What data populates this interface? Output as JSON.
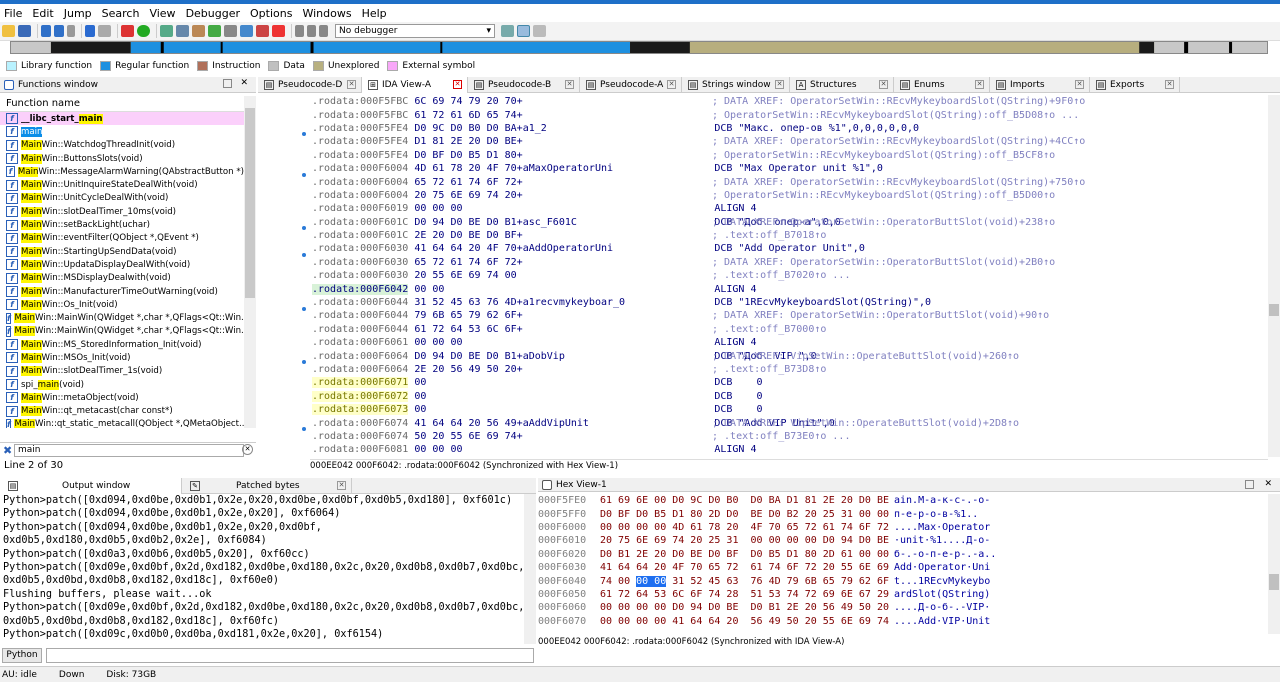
{
  "menu": [
    "File",
    "Edit",
    "Jump",
    "Search",
    "View",
    "Debugger",
    "Options",
    "Windows",
    "Help"
  ],
  "toolbar": {
    "debugger_value": "No debugger"
  },
  "legend": [
    {
      "label": "Library function",
      "color": "#b9f2ff"
    },
    {
      "label": "Regular function",
      "color": "#1e90e0"
    },
    {
      "label": "Instruction",
      "color": "#b0705a"
    },
    {
      "label": "Data",
      "color": "#c0c0c0"
    },
    {
      "label": "Unexplored",
      "color": "#b8b080"
    },
    {
      "label": "External symbol",
      "color": "#f8a8f8"
    }
  ],
  "tabs": [
    {
      "label": "Pseudocode-D"
    },
    {
      "label": "IDA View-A"
    },
    {
      "label": "Pseudocode-B"
    },
    {
      "label": "Pseudocode-A"
    },
    {
      "label": "Strings window"
    },
    {
      "label": "Structures"
    },
    {
      "label": "Enums"
    },
    {
      "label": "Imports"
    },
    {
      "label": "Exports"
    }
  ],
  "functions_window": {
    "title": "Functions window",
    "column": "Function name",
    "search_value": "main",
    "status": "Line 2 of 30",
    "items": [
      {
        "pre": "__libc_start_",
        "hl": "main",
        "post": ""
      },
      {
        "pre": "",
        "hl": "main",
        "post": ""
      },
      {
        "pre": "",
        "hl": "Main",
        "post": "Win::WatchdogThreadInit(void)"
      },
      {
        "pre": "",
        "hl": "Main",
        "post": "Win::ButtonsSlots(void)"
      },
      {
        "pre": "",
        "hl": "Main",
        "post": "Win::MessageAlarmWarning(QAbstractButton *)"
      },
      {
        "pre": "",
        "hl": "Main",
        "post": "Win::UnitInquireStateDealWith(void)"
      },
      {
        "pre": "",
        "hl": "Main",
        "post": "Win::UnitCycleDealWith(void)"
      },
      {
        "pre": "",
        "hl": "Main",
        "post": "Win::slotDealTimer_10ms(void)"
      },
      {
        "pre": "",
        "hl": "Main",
        "post": "Win::setBackLight(uchar)"
      },
      {
        "pre": "",
        "hl": "Main",
        "post": "Win::eventFilter(QObject *,QEvent *)"
      },
      {
        "pre": "",
        "hl": "Main",
        "post": "Win::StartingUpSendData(void)"
      },
      {
        "pre": "",
        "hl": "Main",
        "post": "Win::UpdataDisplayDealWith(void)"
      },
      {
        "pre": "",
        "hl": "Main",
        "post": "Win::MSDisplayDealwith(void)"
      },
      {
        "pre": "",
        "hl": "Main",
        "post": "Win::ManufacturerTimeOutWarning(void)"
      },
      {
        "pre": "",
        "hl": "Main",
        "post": "Win::Os_Init(void)"
      },
      {
        "pre": "",
        "hl": "Main",
        "post": "Win::MainWin(QWidget *,char *,QFlags<Qt::Win..."
      },
      {
        "pre": "",
        "hl": "Main",
        "post": "Win::MainWin(QWidget *,char *,QFlags<Qt::Win..."
      },
      {
        "pre": "",
        "hl": "Main",
        "post": "Win::MS_StoredInformation_Init(void)"
      },
      {
        "pre": "",
        "hl": "Main",
        "post": "Win::MSOs_Init(void)"
      },
      {
        "pre": "",
        "hl": "Main",
        "post": "Win::slotDealTimer_1s(void)"
      },
      {
        "pre": "spi_",
        "hl": "main",
        "post": "(void)"
      },
      {
        "pre": "",
        "hl": "Main",
        "post": "Win::metaObject(void)"
      },
      {
        "pre": "",
        "hl": "Main",
        "post": "Win::qt_metacast(char const*)"
      },
      {
        "pre": "",
        "hl": "Main",
        "post": "Win::qt_static_metacall(QObject *,QMetaObject..."
      }
    ]
  },
  "asm": {
    "lines": [
      {
        "dot": false,
        "cls": "data",
        "addr": ".rodata:000F5FBC",
        "bytes": "6C 69 74 79 20 70+",
        "label": "",
        "ins": "",
        "cmt": "; DATA XREF: OperatorSetWin::REcvMykeyboardSlot(QString)+9F0↑o"
      },
      {
        "dot": false,
        "cls": "data",
        "addr": ".rodata:000F5FBC",
        "bytes": "61 72 61 6D 65 74+",
        "label": "",
        "ins": "",
        "cmt": "; OperatorSetWin::REcvMykeyboardSlot(QString):off_B5D08↑o ..."
      },
      {
        "dot": true,
        "cls": "data",
        "addr": ".rodata:000F5FE4",
        "bytes": "D0 9C D0 B0 D0 BA+a1_2",
        "label": "",
        "ins": "DCB \"Макс. опер-ов %1\",0,0,0,0,0,0",
        "cmt": ""
      },
      {
        "dot": false,
        "cls": "data",
        "addr": ".rodata:000F5FE4",
        "bytes": "D1 81 2E 20 D0 BE+",
        "label": "",
        "ins": "",
        "cmt": "; DATA XREF: OperatorSetWin::REcvMykeyboardSlot(QString)+4CC↑o"
      },
      {
        "dot": false,
        "cls": "data",
        "addr": ".rodata:000F5FE4",
        "bytes": "D0 BF D0 B5 D1 80+",
        "label": "",
        "ins": "",
        "cmt": "; OperatorSetWin::REcvMykeyboardSlot(QString):off_B5CF8↑o"
      },
      {
        "dot": true,
        "cls": "data",
        "addr": ".rodata:000F6004",
        "bytes": "4D 61 78 20 4F 70+aMaxOperatorUni",
        "label": "",
        "ins": "DCB \"Max Operator unit %1\",0",
        "cmt": ""
      },
      {
        "dot": false,
        "cls": "data",
        "addr": ".rodata:000F6004",
        "bytes": "65 72 61 74 6F 72+",
        "label": "",
        "ins": "",
        "cmt": "; DATA XREF: OperatorSetWin::REcvMykeyboardSlot(QString)+750↑o"
      },
      {
        "dot": false,
        "cls": "data",
        "addr": ".rodata:000F6004",
        "bytes": "20 75 6E 69 74 20+",
        "label": "",
        "ins": "",
        "cmt": "; OperatorSetWin::REcvMykeyboardSlot(QString):off_B5D00↑o"
      },
      {
        "dot": false,
        "cls": "data",
        "addr": ".rodata:000F6019",
        "bytes": "00 00 00",
        "label": "",
        "ins": "ALIGN 4",
        "cmt": ""
      },
      {
        "dot": true,
        "cls": "data",
        "addr": ".rodata:000F601C",
        "bytes": "D0 94 D0 BE D0 B1+asc_F601C",
        "label": "",
        "ins": "DCB \"Доб. опер-а\",0,0",
        "cmt": "; DATA XREF: OperatorSetWin::OperatorButtSlot(void)+238↑o"
      },
      {
        "dot": false,
        "cls": "data",
        "addr": ".rodata:000F601C",
        "bytes": "2E 20 D0 BE D0 BF+",
        "label": "",
        "ins": "",
        "cmt": "; .text:off_B7018↑o"
      },
      {
        "dot": true,
        "cls": "data",
        "addr": ".rodata:000F6030",
        "bytes": "41 64 64 20 4F 70+aAddOperatorUni",
        "label": "",
        "ins": "DCB \"Add Operator Unit\",0",
        "cmt": ""
      },
      {
        "dot": false,
        "cls": "data",
        "addr": ".rodata:000F6030",
        "bytes": "65 72 61 74 6F 72+",
        "label": "",
        "ins": "",
        "cmt": "; DATA XREF: OperatorSetWin::OperatorButtSlot(void)+2B0↑o"
      },
      {
        "dot": false,
        "cls": "data",
        "addr": ".rodata:000F6030",
        "bytes": "20 55 6E 69 74 00",
        "label": "",
        "ins": "",
        "cmt": "; .text:off_B7020↑o ..."
      },
      {
        "dot": false,
        "cls": "hi",
        "addr": ".rodata:000F6042",
        "bytes": "00 00",
        "label": "",
        "ins": "ALIGN 4",
        "cmt": ""
      },
      {
        "dot": true,
        "cls": "data",
        "addr": ".rodata:000F6044",
        "bytes": "31 52 45 63 76 4D+a1recvmykeyboar_0",
        "label": "",
        "ins": "DCB \"1REcvMykeyboardSlot(QString)\",0",
        "cmt": ""
      },
      {
        "dot": false,
        "cls": "data",
        "addr": ".rodata:000F6044",
        "bytes": "79 6B 65 79 62 6F+",
        "label": "",
        "ins": "",
        "cmt": "; DATA XREF: OperatorSetWin::OperatorButtSlot(void)+90↑o"
      },
      {
        "dot": false,
        "cls": "data",
        "addr": ".rodata:000F6044",
        "bytes": "61 72 64 53 6C 6F+",
        "label": "",
        "ins": "",
        "cmt": "; .text:off_B7000↑o"
      },
      {
        "dot": false,
        "cls": "data",
        "addr": ".rodata:000F6061",
        "bytes": "00 00 00",
        "label": "",
        "ins": "ALIGN 4",
        "cmt": ""
      },
      {
        "dot": true,
        "cls": "data",
        "addr": ".rodata:000F6064",
        "bytes": "D0 94 D0 BE D0 B1+aDobVip",
        "label": "",
        "ins": "DCB \"Доб. VIP \",0",
        "cmt": "; DATA XREF: VipSetWin::OperateButtSlot(void)+260↑o"
      },
      {
        "dot": false,
        "cls": "data",
        "addr": ".rodata:000F6064",
        "bytes": "2E 20 56 49 50 20+",
        "label": "",
        "ins": "",
        "cmt": "; .text:off_B73D8↑o"
      },
      {
        "dot": false,
        "cls": "yel",
        "addr": ".rodata:000F6071",
        "bytes": "00",
        "label": "",
        "ins": "DCB    0",
        "cmt": ""
      },
      {
        "dot": false,
        "cls": "yel",
        "addr": ".rodata:000F6072",
        "bytes": "00",
        "label": "",
        "ins": "DCB    0",
        "cmt": ""
      },
      {
        "dot": false,
        "cls": "yel",
        "addr": ".rodata:000F6073",
        "bytes": "00",
        "label": "",
        "ins": "DCB    0",
        "cmt": ""
      },
      {
        "dot": true,
        "cls": "data",
        "addr": ".rodata:000F6074",
        "bytes": "41 64 64 20 56 49+aAddVipUnit",
        "label": "",
        "ins": "DCB \"Add VIP Unit\",0",
        "cmt": "; DATA XREF: VipSetWin::OperateButtSlot(void)+2D8↑o"
      },
      {
        "dot": false,
        "cls": "data",
        "addr": ".rodata:000F6074",
        "bytes": "50 20 55 6E 69 74+",
        "label": "",
        "ins": "",
        "cmt": "; .text:off_B73E0↑o ..."
      },
      {
        "dot": false,
        "cls": "data",
        "addr": ".rodata:000F6081",
        "bytes": "00 00 00",
        "label": "",
        "ins": "ALIGN 4",
        "cmt": ""
      }
    ],
    "status": "000EE042 000F6042: .rodata:000F6042 (Synchronized with Hex View-1)"
  },
  "output": {
    "tab_output": "Output window",
    "tab_patched": "Patched bytes",
    "lines": [
      "Python>patch([0xd094,0xd0be,0xd0b1,0x2e,0x20,0xd0be,0xd0bf,0xd0b5,0xd180], 0xf601c)",
      "Python>patch([0xd094,0xd0be,0xd0b1,0x2e,0x20], 0xf6064)",
      "Python>patch([0xd094,0xd0be,0xd0b1,0x2e,0x20,0xd0bf,",
      "0xd0b5,0xd180,0xd0b5,0xd0b2,0x2e], 0xf6084)",
      "Python>patch([0xd0a3,0xd0b6,0xd0b5,0x20], 0xf60cc)",
      "Python>patch([0xd09e,0xd0bf,0x2d,0xd182,0xd0be,0xd180,0x2c,0x20,0xd0b8,0xd0b7,0xd0bc,",
      "0xd0b5,0xd0bd,0xd0b8,0xd182,0xd18c], 0xf60e0)",
      "Flushing buffers, please wait...ok",
      "Python>patch([0xd09e,0xd0bf,0x2d,0xd182,0xd0be,0xd180,0x2c,0x20,0xd0b8,0xd0b7,0xd0bc,",
      "0xd0b5,0xd0bd,0xd0b8,0xd182,0xd18c], 0xf60fc)",
      "Python>patch([0xd09c,0xd0b0,0xd0ba,0xd181,0x2e,0x20], 0xf6154)"
    ],
    "python_button": "Python"
  },
  "hex": {
    "title": "Hex View-1",
    "rows": [
      {
        "addr": "000F5FE0",
        "b1": "61 69 6E 00 D0 9C D0 B0",
        "b2": "D0 BA D1 81 2E 20 D0 BE",
        "s": "ain.М-а-к-с-.-о-"
      },
      {
        "addr": "000F5FF0",
        "b1": "D0 BF D0 B5 D1 80 2D D0",
        "b2": "BE D0 B2 20 25 31 00 00",
        "s": "п-е-р-о-в-%1.."
      },
      {
        "addr": "000F6000",
        "b1": "00 00 00 00 4D 61 78 20",
        "b2": "4F 70 65 72 61 74 6F 72",
        "s": "....Max·Operator"
      },
      {
        "addr": "000F6010",
        "b1": "20 75 6E 69 74 20 25 31",
        "b2": "00 00 00 00 D0 94 D0 BE",
        "s": "·unit·%1....Д-о-"
      },
      {
        "addr": "000F6020",
        "b1": "D0 B1 2E 20 D0 BE D0 BF",
        "b2": "D0 B5 D1 80 2D 61 00 00",
        "s": "б-.-о-п-е-р-.-а.."
      },
      {
        "addr": "000F6030",
        "b1": "41 64 64 20 4F 70 65 72",
        "b2": "61 74 6F 72 20 55 6E 69",
        "s": "Add·Operator·Uni"
      },
      {
        "addr": "000F6040",
        "b1a": "74 00 ",
        "sel": "00 00",
        "b1b": " 31 52 45 63",
        "b2": "76 4D 79 6B 65 79 62 6F",
        "s": "t...1REcvMykeybo"
      },
      {
        "addr": "000F6050",
        "b1": "61 72 64 53 6C 6F 74 28",
        "b2": "51 53 74 72 69 6E 67 29",
        "s": "ardSlot(QString)"
      },
      {
        "addr": "000F6060",
        "b1": "00 00 00 00 D0 94 D0 BE",
        "b2": "D0 B1 2E 20 56 49 50 20",
        "s": "....Д-о-б-.-VIP·"
      },
      {
        "addr": "000F6070",
        "b1": "00 00 00 00 41 64 64 20",
        "b2": "56 49 50 20 55 6E 69 74",
        "s": "....Add·VIP·Unit"
      }
    ],
    "status": "000EE042 000F6042: .rodata:000F6042 (Synchronized with IDA View-A)"
  },
  "statusbar": {
    "au": "AU:  idle",
    "dir": "Down",
    "disk": "Disk: 73GB"
  }
}
